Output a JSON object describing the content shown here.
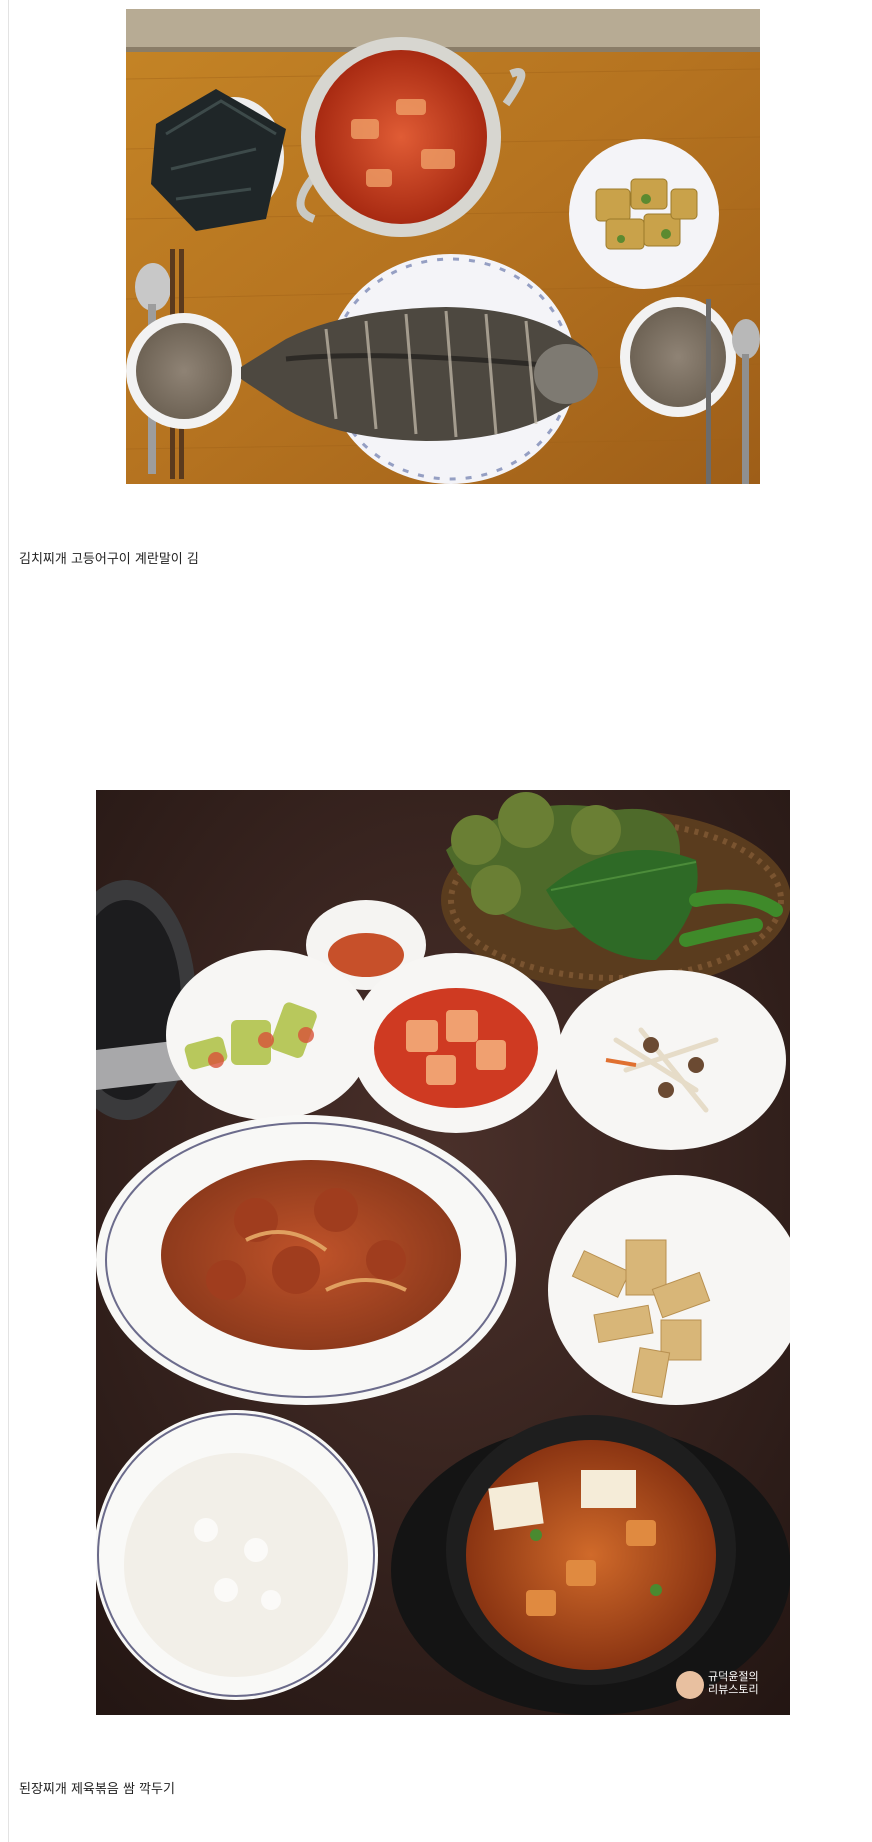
{
  "post": {
    "photo1": {
      "caption": "김치찌개 고등어구이 계란말이 김",
      "colors": {
        "table": "#b9781f",
        "wall": "#b7ab94",
        "plate": "#f4f4f8",
        "stew": "#c93c1c"
      }
    },
    "photo2": {
      "caption": "된장찌개 제육볶음 쌈 깍두기",
      "watermark": "규덕윤절의 리뷰스토리",
      "colors": {
        "table": "#3a2520",
        "bowl": "#f7f6f4",
        "sauce": "#cc4a1f"
      }
    }
  }
}
